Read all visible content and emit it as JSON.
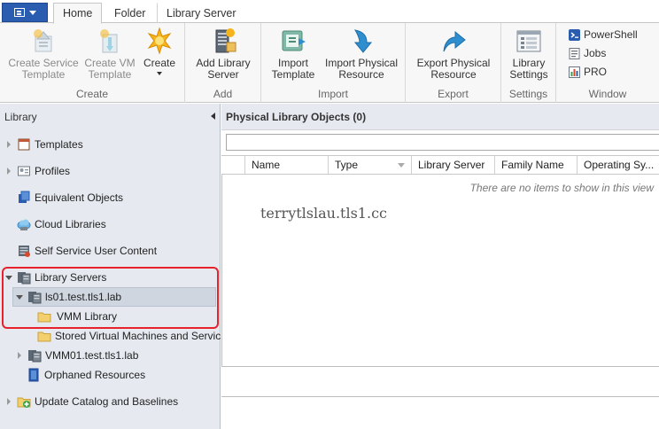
{
  "ribbon_tabs": [
    "Home",
    "Folder",
    "Library Server"
  ],
  "groups": {
    "create": {
      "label": "Create",
      "create_service_template": "Create Service\nTemplate",
      "create_vm_template": "Create VM\nTemplate",
      "create": "Create"
    },
    "add": {
      "label": "Add",
      "add_library_server": "Add Library\nServer"
    },
    "import": {
      "label": "Import",
      "import_template": "Import\nTemplate",
      "import_physical_resource": "Import Physical\nResource"
    },
    "export": {
      "label": "Export",
      "export_physical_resource": "Export Physical\nResource"
    },
    "settings": {
      "label": "Settings",
      "library_settings": "Library\nSettings"
    },
    "window": {
      "label": "Window",
      "powershell": "PowerShell",
      "jobs": "Jobs",
      "pro": "PRO"
    }
  },
  "nav": {
    "title": "Library",
    "items": [
      {
        "label": "Templates"
      },
      {
        "label": "Profiles"
      },
      {
        "label": "Equivalent Objects"
      },
      {
        "label": "Cloud Libraries"
      },
      {
        "label": "Self Service User Content"
      },
      {
        "label": "Library Servers"
      },
      {
        "label": "ls01.test.tls1.lab"
      },
      {
        "label": "VMM Library"
      },
      {
        "label": "Stored Virtual Machines and Servic"
      },
      {
        "label": "VMM01.test.tls1.lab"
      },
      {
        "label": "Orphaned Resources"
      },
      {
        "label": "Update Catalog and Baselines"
      }
    ]
  },
  "content": {
    "title": "Physical Library Objects (0)",
    "columns": [
      "Name",
      "Type",
      "Library Server",
      "Family Name",
      "Operating Sy..."
    ],
    "empty_message": "There are no items to show in this view",
    "watermark": "terrytlslau.tls1.cc"
  },
  "colors": {
    "app_button": "#2a5db0",
    "nav_background": "#e6eaf0",
    "selection": "#cfd6e0",
    "highlight_box": "#e8222a"
  }
}
